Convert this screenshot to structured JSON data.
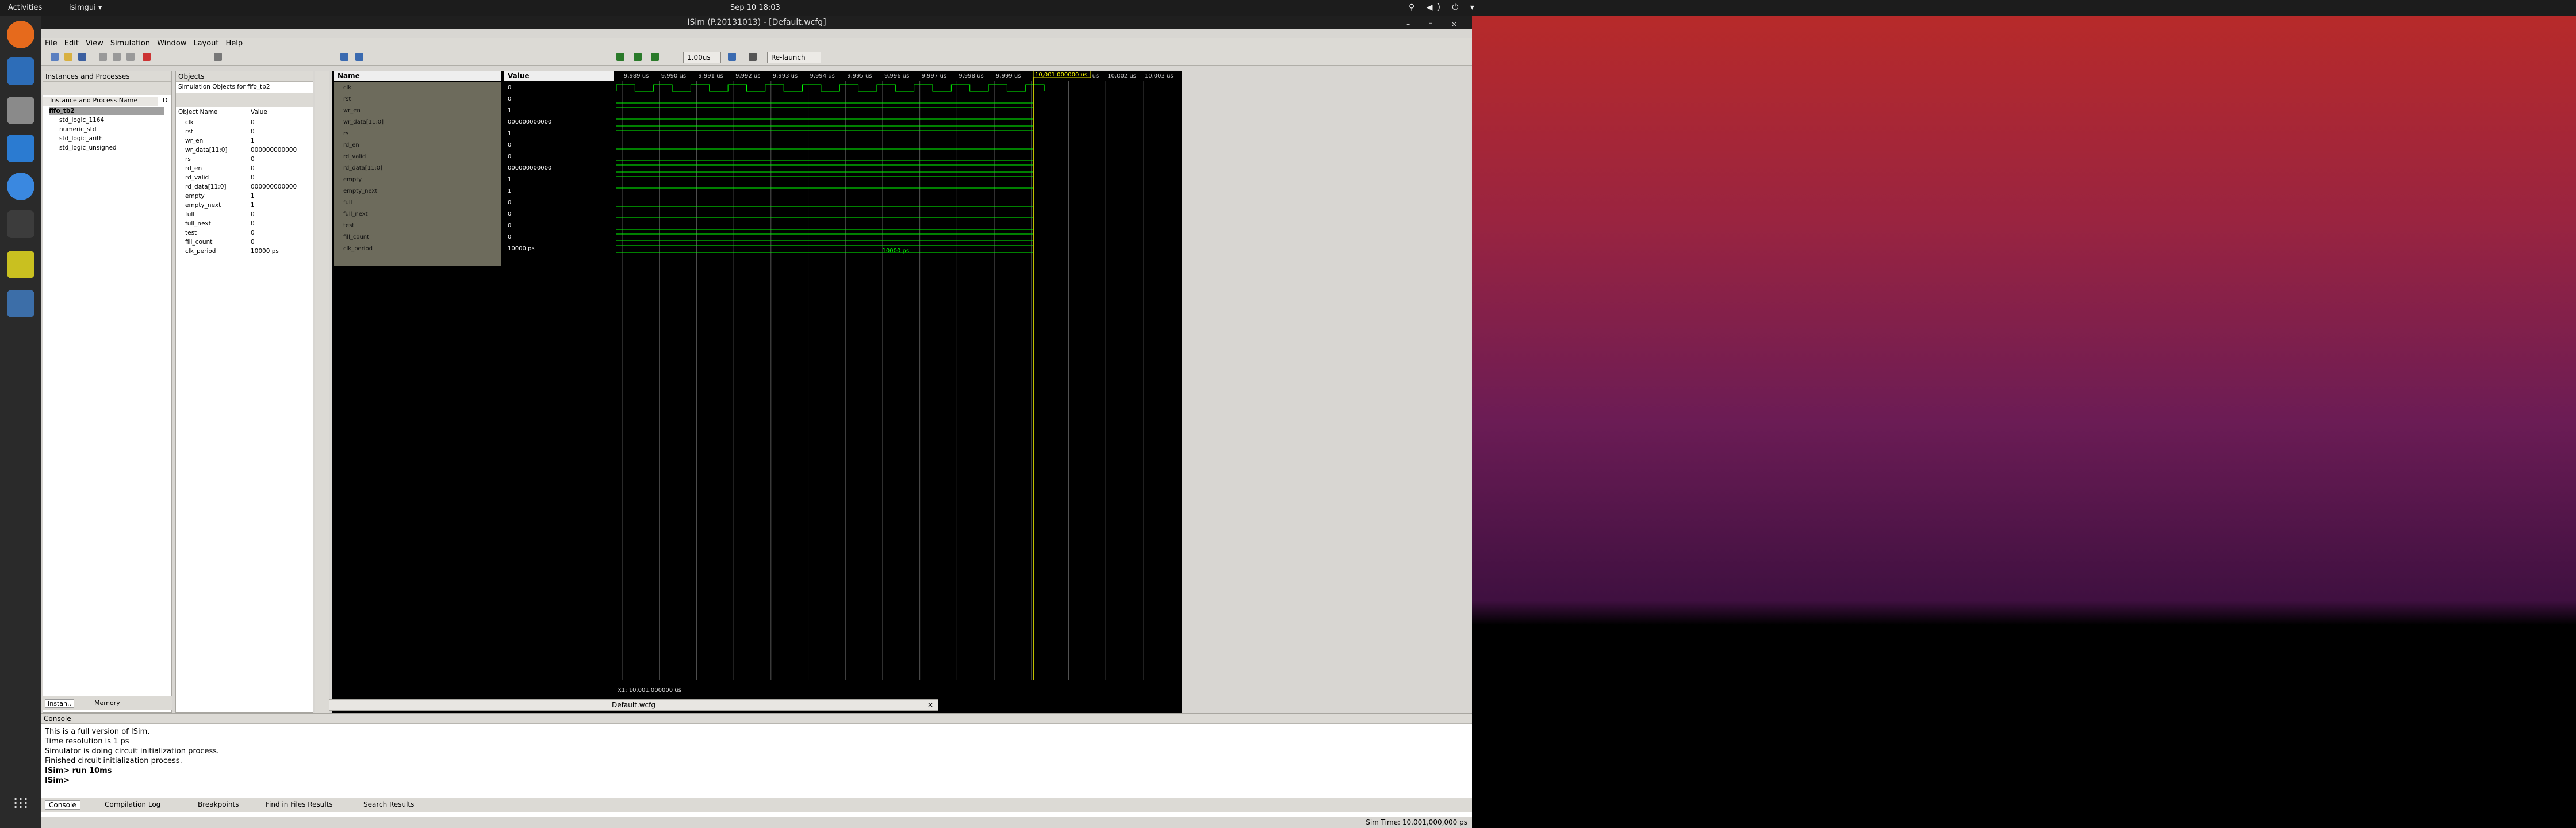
{
  "top_bar": {
    "activities": "Activities",
    "app": "isimgui ▾",
    "clock": "Sep 10  18:03",
    "tray": "⚲ ◀) ⏻ ▾"
  },
  "window": {
    "title": "ISim (P.20131013) - [Default.wcfg]",
    "controls": "–  ▫  ×"
  },
  "menu": [
    "File",
    "Edit",
    "View",
    "Simulation",
    "Window",
    "Layout",
    "Help"
  ],
  "toolbar": {
    "time_value": "1.00us",
    "relaunch": "Re-launch"
  },
  "instances_panel": {
    "title": "Instances and Processes",
    "column": "Instance and Process Name",
    "col2": "D",
    "items": [
      {
        "label": "fifo_tb2",
        "selected": true
      },
      {
        "label": "std_logic_1164"
      },
      {
        "label": "numeric_std"
      },
      {
        "label": "std_logic_arith"
      },
      {
        "label": "std_logic_unsigned"
      }
    ]
  },
  "objects_panel": {
    "title": "Objects",
    "subtitle": "Simulation Objects for fifo_tb2",
    "col_name": "Object Name",
    "col_value": "Value",
    "items": [
      {
        "name": "clk",
        "value": "0"
      },
      {
        "name": "rst",
        "value": "0"
      },
      {
        "name": "wr_en",
        "value": "1"
      },
      {
        "name": "wr_data[11:0]",
        "value": "000000000000"
      },
      {
        "name": "rs",
        "value": "0"
      },
      {
        "name": "rd_en",
        "value": "0"
      },
      {
        "name": "rd_valid",
        "value": "0"
      },
      {
        "name": "rd_data[11:0]",
        "value": "000000000000"
      },
      {
        "name": "empty",
        "value": "1"
      },
      {
        "name": "empty_next",
        "value": "1"
      },
      {
        "name": "full",
        "value": "0"
      },
      {
        "name": "full_next",
        "value": "0"
      },
      {
        "name": "test",
        "value": "0"
      },
      {
        "name": "fill_count",
        "value": "0"
      },
      {
        "name": "clk_period",
        "value": "10000 ps"
      }
    ]
  },
  "left_tabs": {
    "instances": "Instan..",
    "memory": "Memory"
  },
  "wave": {
    "name_header": "Name",
    "value_header": "Value",
    "signals": [
      {
        "name": "clk",
        "value": "0"
      },
      {
        "name": "rst",
        "value": "0"
      },
      {
        "name": "wr_en",
        "value": "1"
      },
      {
        "name": "wr_data[11:0]",
        "value": "000000000000"
      },
      {
        "name": "rs",
        "value": "1"
      },
      {
        "name": "rd_en",
        "value": "0"
      },
      {
        "name": "rd_valid",
        "value": "0"
      },
      {
        "name": "rd_data[11:0]",
        "value": "000000000000"
      },
      {
        "name": "empty",
        "value": "1"
      },
      {
        "name": "empty_next",
        "value": "1"
      },
      {
        "name": "full",
        "value": "0"
      },
      {
        "name": "full_next",
        "value": "0"
      },
      {
        "name": "test",
        "value": "0"
      },
      {
        "name": "fill_count",
        "value": "0"
      },
      {
        "name": "clk_period",
        "value": "10000 ps"
      }
    ],
    "ticks": [
      "9,989 us",
      "9,990 us",
      "9,991 us",
      "9,992 us",
      "9,993 us",
      "9,994 us",
      "9,995 us",
      "9,996 us",
      "9,997 us",
      "9,998 us",
      "9,999 us",
      "10,000 us",
      "10,001 us",
      "10,002 us",
      "10,003 us"
    ],
    "cursor_label": "10,001.000000 us",
    "cursor_readout": "X1: 10,001.000000 us",
    "period_label": "10000 ps",
    "tab": "Default.wcfg"
  },
  "console": {
    "title": "Console",
    "lines": [
      "This is a full version of ISim.",
      "Time resolution is 1 ps",
      "Simulator is doing circuit initialization process.",
      "Finished circuit initialization process.",
      "ISim>  run 10ms",
      "ISim>"
    ]
  },
  "bottom_tabs": [
    "Console",
    "Compilation Log",
    "Breakpoints",
    "Find in Files Results",
    "Search Results"
  ],
  "status": {
    "sim_time": "Sim Time: 10,001,000,000 ps"
  },
  "colors": {
    "wave": "#00ff00",
    "cursor": "#ffff00",
    "grid": "#555555"
  }
}
